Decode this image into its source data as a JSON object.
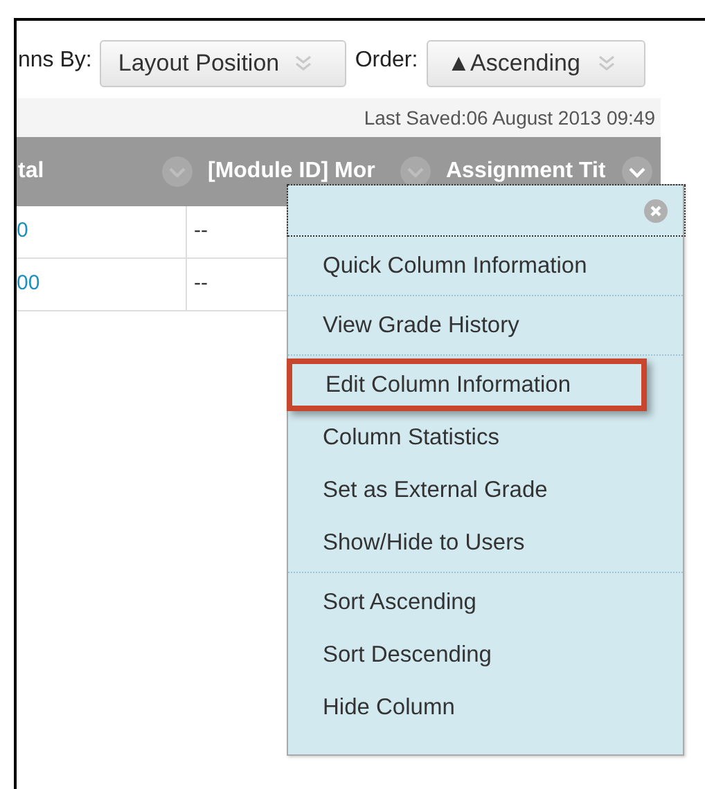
{
  "toolbar": {
    "columns_label": "nns By:",
    "columns_value": "Layout Position",
    "order_label": "Order:",
    "order_value": "▲Ascending"
  },
  "last_saved": "Last Saved:06 August 2013 09:49",
  "table": {
    "columns": [
      "tal",
      "[Module ID] Mor",
      "Assignment Tit"
    ],
    "rows": [
      [
        "0",
        "--"
      ],
      [
        "00",
        "--"
      ]
    ]
  },
  "menu": {
    "groups": [
      [
        {
          "label": "Quick Column Information",
          "highlighted": false
        }
      ],
      [
        {
          "label": "View Grade History",
          "highlighted": false
        }
      ],
      [
        {
          "label": "Edit Column Information",
          "highlighted": true
        },
        {
          "label": "Column Statistics",
          "highlighted": false
        },
        {
          "label": "Set as External Grade",
          "highlighted": false
        },
        {
          "label": "Show/Hide to Users",
          "highlighted": false
        }
      ],
      [
        {
          "label": "Sort Ascending",
          "highlighted": false
        },
        {
          "label": "Sort Descending",
          "highlighted": false
        },
        {
          "label": "Hide Column",
          "highlighted": false
        }
      ]
    ]
  }
}
